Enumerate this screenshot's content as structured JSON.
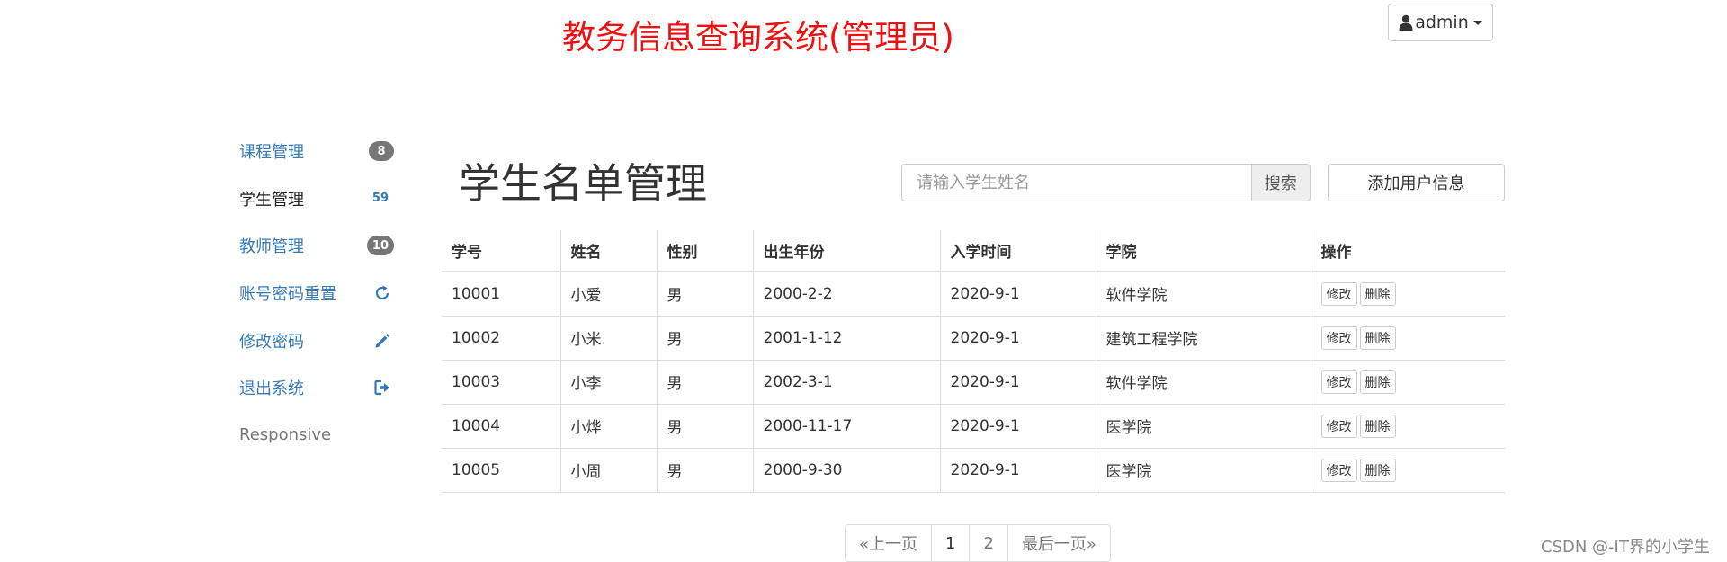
{
  "header": {
    "title": "教务信息查询系统(管理员)",
    "user_menu_label": "admin"
  },
  "sidebar": {
    "items": [
      {
        "label": "课程管理",
        "badge": "8"
      },
      {
        "label": "学生管理",
        "badge": "59"
      },
      {
        "label": "教师管理",
        "badge": "10"
      },
      {
        "label": "账号密码重置",
        "icon": "refresh-icon"
      },
      {
        "label": "修改密码",
        "icon": "pencil-icon"
      },
      {
        "label": "退出系统",
        "icon": "logout-icon"
      },
      {
        "label": "Responsive"
      }
    ]
  },
  "main": {
    "heading": "学生名单管理",
    "search": {
      "placeholder": "请输入学生姓名",
      "button_label": "搜索"
    },
    "add_button_label": "添加用户信息",
    "table": {
      "columns": [
        "学号",
        "姓名",
        "性别",
        "出生年份",
        "入学时间",
        "学院",
        "操作"
      ],
      "rows": [
        [
          "10001",
          "小爱",
          "男",
          "2000-2-2",
          "2020-9-1",
          "软件学院"
        ],
        [
          "10002",
          "小米",
          "男",
          "2001-1-12",
          "2020-9-1",
          "建筑工程学院"
        ],
        [
          "10003",
          "小李",
          "男",
          "2002-3-1",
          "2020-9-1",
          "软件学院"
        ],
        [
          "10004",
          "小烨",
          "男",
          "2000-11-17",
          "2020-9-1",
          "医学院"
        ],
        [
          "10005",
          "小周",
          "男",
          "2000-9-30",
          "2020-9-1",
          "医学院"
        ]
      ],
      "edit_label": "修改",
      "delete_label": "删除"
    },
    "pagination": {
      "prev_label": "«上一页",
      "pages": [
        "1",
        "2"
      ],
      "current_page": "1",
      "last_label": "最后一页»"
    }
  },
  "watermark": "CSDN @-IT界的小学生",
  "colors": {
    "title": "#ee1111",
    "link": "#337ab7",
    "badge": "#777777",
    "border": "#dddddd"
  }
}
